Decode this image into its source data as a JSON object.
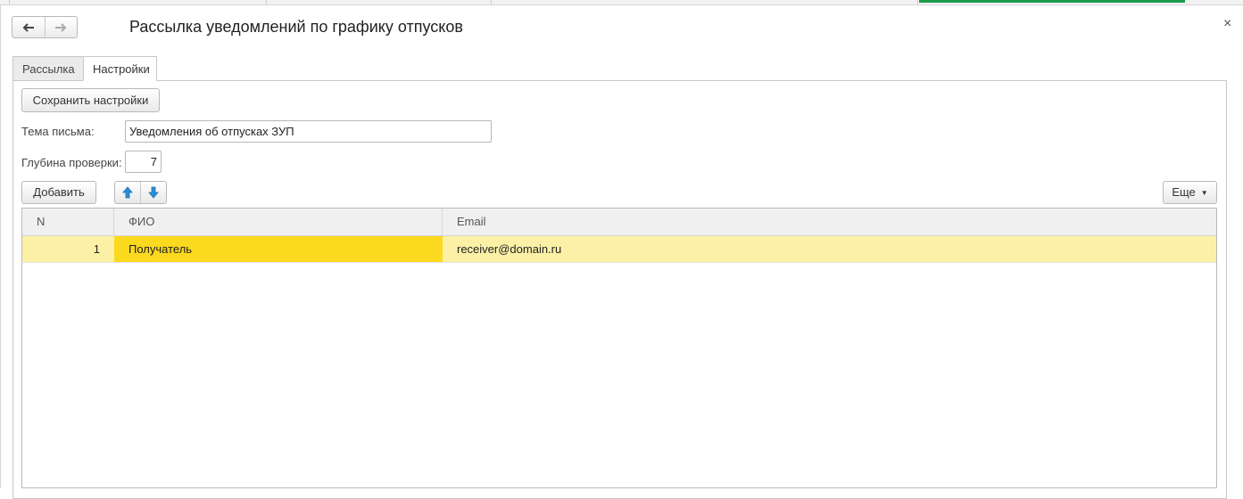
{
  "window": {
    "title": "Рассылка уведомлений по графику отпусков",
    "close": "×"
  },
  "tabs": [
    {
      "label": "Рассылка",
      "active": false
    },
    {
      "label": "Настройки",
      "active": true
    }
  ],
  "settings": {
    "save_button": "Сохранить настройки",
    "subject_label": "Тема письма:",
    "subject_value": "Уведомления об отпусках ЗУП",
    "depth_label": "Глубина проверки:",
    "depth_value": "7"
  },
  "toolbar": {
    "add_button": "Добавить",
    "more_button": "Еще",
    "icons": [
      "arrow-up-icon",
      "arrow-down-icon"
    ]
  },
  "table": {
    "columns": [
      "N",
      "ФИО",
      "Email"
    ],
    "rows": [
      {
        "n": "1",
        "fio": "Получатель",
        "email": "receiver@domain.ru",
        "selected": true
      }
    ]
  },
  "colors": {
    "selected_row": "#fbf0a5",
    "selected_cell": "#fbd91f",
    "arrow_icon": "#2b8fd6",
    "active_window": "#1a9a4a"
  }
}
